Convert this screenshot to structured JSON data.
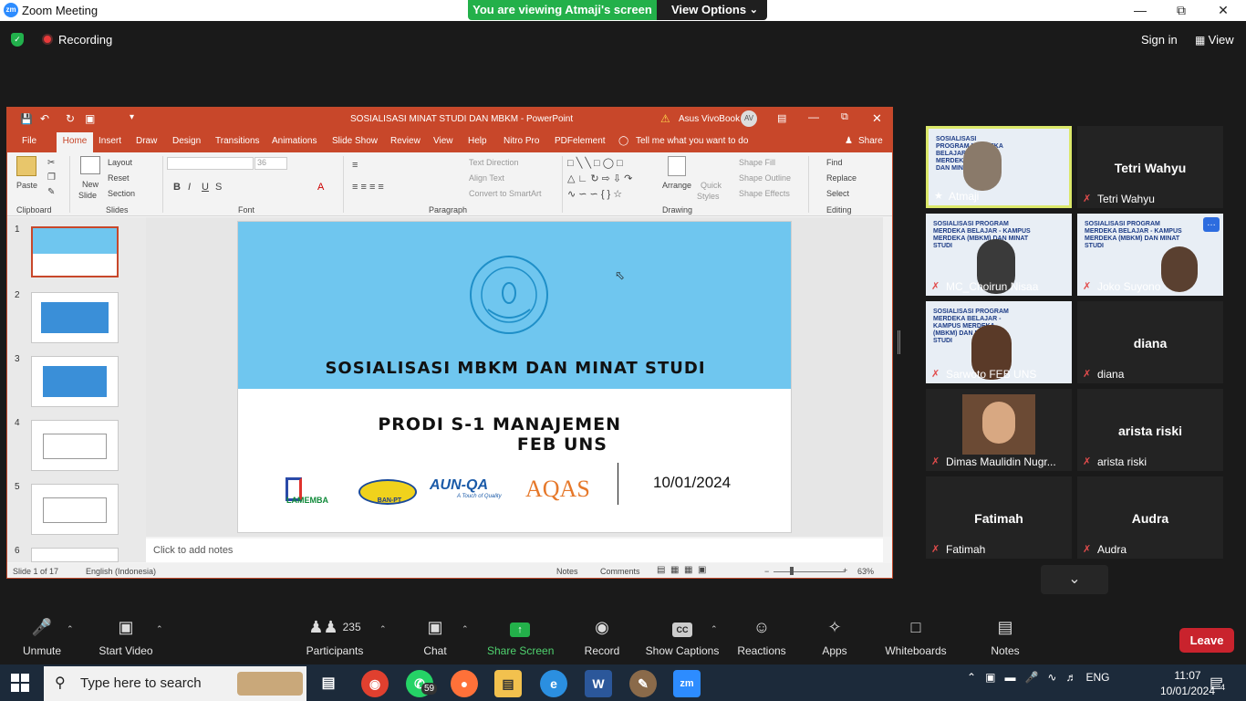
{
  "window": {
    "title": "Zoom Meeting",
    "logo": "zm"
  },
  "banner": {
    "viewing": "You are viewing Atmaji's screen",
    "view_options": "View Options"
  },
  "topbar": {
    "recording": "Recording",
    "signin": "Sign in",
    "view": "View"
  },
  "ppt": {
    "title": "SOSIALISASI MINAT STUDI DAN MBKM  -  PowerPoint",
    "user": "Asus VivoBook",
    "user_initials": "AV",
    "tabs": [
      "File",
      "Home",
      "Insert",
      "Draw",
      "Design",
      "Transitions",
      "Animations",
      "Slide Show",
      "Review",
      "View",
      "Help",
      "Nitro Pro",
      "PDFelement"
    ],
    "tell_me": "Tell me what you want to do",
    "share": "Share",
    "ribbon": {
      "paste": "Paste",
      "new_slide_1": "New",
      "new_slide_2": "Slide",
      "layout": "Layout",
      "reset": "Reset",
      "section": "Section",
      "font_size": "36",
      "text_direction": "Text Direction",
      "align_text": "Align Text",
      "convert": "Convert to SmartArt",
      "arrange": "Arrange",
      "quick_styles_1": "Quick",
      "quick_styles_2": "Styles",
      "shape_fill": "Shape Fill",
      "shape_outline": "Shape Outline",
      "shape_effects": "Shape Effects",
      "find": "Find",
      "replace": "Replace",
      "select": "Select",
      "groups": {
        "clipboard": "Clipboard",
        "slides": "Slides",
        "font": "Font",
        "paragraph": "Paragraph",
        "drawing": "Drawing",
        "editing": "Editing"
      }
    },
    "thumbs": [
      "1",
      "2",
      "3",
      "4",
      "5",
      "6"
    ],
    "slide": {
      "title": "SOSIALISASI MBKM DAN MINAT STUDI",
      "prodi_line1": "PRODI S-1 MANAJEMEN",
      "prodi_line2": "FEB UNS",
      "date": "10/01/2024",
      "logos": [
        "LAMEMBA",
        "BAN-PT",
        "AUN-QA",
        "AQAS"
      ],
      "aun_tag": "A Touch of Quality"
    },
    "notes_placeholder": "Click to add notes",
    "status": {
      "slide": "Slide 1 of 17",
      "language": "English (Indonesia)",
      "notes": "Notes",
      "comments": "Comments",
      "zoom": "63%"
    }
  },
  "participants": [
    {
      "name": "Atmaji",
      "video": true,
      "active": true
    },
    {
      "name": "Tetri Wahyu",
      "video": false
    },
    {
      "name": "MC_Choirun Nisaa",
      "video": true
    },
    {
      "name": "Joko Suyono",
      "video": true
    },
    {
      "name": "Sarwoto FEB UNS",
      "video": true
    },
    {
      "name": "diana",
      "video": false
    },
    {
      "name": "Dimas Maulidin Nugr...",
      "video": true
    },
    {
      "name": "arista riski",
      "video": false
    },
    {
      "name": "Fatimah",
      "video": false
    },
    {
      "name": "Audra",
      "video": false
    }
  ],
  "tile_text": {
    "header": "SOSIALISASI PROGRAM MERDEKA BELAJAR - KAMPUS MERDEKA (MBKM) DAN MINAT STUDI"
  },
  "toolbar": {
    "unmute": "Unmute",
    "start_video": "Start Video",
    "participants": "Participants",
    "participants_count": "235",
    "chat": "Chat",
    "share_screen": "Share Screen",
    "record": "Record",
    "show_captions": "Show Captions",
    "reactions": "Reactions",
    "apps": "Apps",
    "whiteboards": "Whiteboards",
    "notes": "Notes",
    "leave": "Leave"
  },
  "taskbar": {
    "search_placeholder": "Type here to search",
    "whatsapp_badge": "59",
    "language": "ENG",
    "time": "11:07",
    "date": "10/01/2024",
    "notifications": "4"
  }
}
